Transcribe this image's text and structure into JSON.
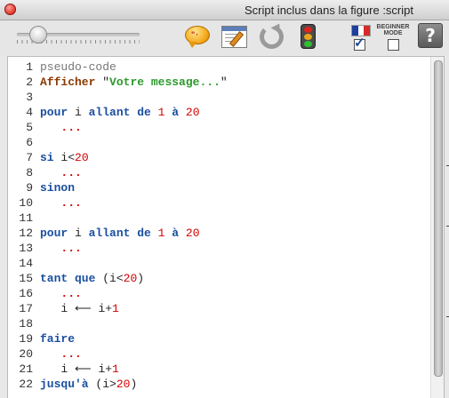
{
  "window": {
    "title": "Script inclus dans la figure :script"
  },
  "toolbar": {
    "slider_value": 0.15,
    "icons": [
      "speech-bubble-icon",
      "editor-window-icon",
      "refresh-icon",
      "traffic-light-icon",
      "french-flag-icon",
      "help-icon"
    ],
    "beginner_line1": "BEGINNER",
    "beginner_line2": "MODE",
    "language_checked": true,
    "beginner_checked": false,
    "help_label": "?"
  },
  "colors": {
    "keyword": "#1b4fa0",
    "string": "#2c9a2c",
    "number": "#d40000",
    "function": "#8b3a00",
    "comment": "#777777"
  },
  "code": {
    "lines": [
      {
        "num": "1",
        "tokens": [
          {
            "t": "pseudo-code",
            "c": "cmt"
          }
        ]
      },
      {
        "num": "2",
        "tokens": [
          {
            "t": "Afficher",
            "c": "fn"
          },
          {
            "t": " ",
            "c": "plain"
          },
          {
            "t": "\"",
            "c": "plain"
          },
          {
            "t": "Votre message...",
            "c": "str"
          },
          {
            "t": "\"",
            "c": "plain"
          }
        ]
      },
      {
        "num": "3",
        "tokens": []
      },
      {
        "num": "4",
        "tokens": [
          {
            "t": "pour",
            "c": "kw"
          },
          {
            "t": " i ",
            "c": "plain"
          },
          {
            "t": "allant de",
            "c": "kw"
          },
          {
            "t": " ",
            "c": "plain"
          },
          {
            "t": "1",
            "c": "num"
          },
          {
            "t": " ",
            "c": "plain"
          },
          {
            "t": "à",
            "c": "kw"
          },
          {
            "t": " ",
            "c": "plain"
          },
          {
            "t": "20",
            "c": "num"
          }
        ]
      },
      {
        "num": "5",
        "tokens": [
          {
            "t": "   ",
            "c": "plain"
          },
          {
            "t": "...",
            "c": "dots"
          }
        ]
      },
      {
        "num": "6",
        "tokens": []
      },
      {
        "num": "7",
        "tokens": [
          {
            "t": "si",
            "c": "kw"
          },
          {
            "t": " i<",
            "c": "plain"
          },
          {
            "t": "20",
            "c": "num"
          }
        ]
      },
      {
        "num": "8",
        "tokens": [
          {
            "t": "   ",
            "c": "plain"
          },
          {
            "t": "...",
            "c": "dots"
          }
        ]
      },
      {
        "num": "9",
        "tokens": [
          {
            "t": "sinon",
            "c": "kw"
          }
        ]
      },
      {
        "num": "10",
        "tokens": [
          {
            "t": "   ",
            "c": "plain"
          },
          {
            "t": "...",
            "c": "dots"
          }
        ]
      },
      {
        "num": "11",
        "tokens": []
      },
      {
        "num": "12",
        "tokens": [
          {
            "t": "pour",
            "c": "kw"
          },
          {
            "t": " i ",
            "c": "plain"
          },
          {
            "t": "allant de",
            "c": "kw"
          },
          {
            "t": " ",
            "c": "plain"
          },
          {
            "t": "1",
            "c": "num"
          },
          {
            "t": " ",
            "c": "plain"
          },
          {
            "t": "à",
            "c": "kw"
          },
          {
            "t": " ",
            "c": "plain"
          },
          {
            "t": "20",
            "c": "num"
          }
        ]
      },
      {
        "num": "13",
        "tokens": [
          {
            "t": "   ",
            "c": "plain"
          },
          {
            "t": "...",
            "c": "dots"
          }
        ]
      },
      {
        "num": "14",
        "tokens": []
      },
      {
        "num": "15",
        "tokens": [
          {
            "t": "tant que",
            "c": "kw"
          },
          {
            "t": " (i<",
            "c": "plain"
          },
          {
            "t": "20",
            "c": "num"
          },
          {
            "t": ")",
            "c": "plain"
          }
        ]
      },
      {
        "num": "16",
        "tokens": [
          {
            "t": "   ",
            "c": "plain"
          },
          {
            "t": "...",
            "c": "dots"
          }
        ]
      },
      {
        "num": "17",
        "tokens": [
          {
            "t": "   i ⟵ i+",
            "c": "plain"
          },
          {
            "t": "1",
            "c": "num"
          }
        ]
      },
      {
        "num": "18",
        "tokens": []
      },
      {
        "num": "19",
        "tokens": [
          {
            "t": "faire",
            "c": "kw"
          }
        ]
      },
      {
        "num": "20",
        "tokens": [
          {
            "t": "   ",
            "c": "plain"
          },
          {
            "t": "...",
            "c": "dots"
          }
        ]
      },
      {
        "num": "21",
        "tokens": [
          {
            "t": "   i ⟵ i+",
            "c": "plain"
          },
          {
            "t": "1",
            "c": "num"
          }
        ]
      },
      {
        "num": "22",
        "tokens": [
          {
            "t": "jusqu'à",
            "c": "kw"
          },
          {
            "t": " (i>",
            "c": "plain"
          },
          {
            "t": "20",
            "c": "num"
          },
          {
            "t": ")",
            "c": "plain"
          }
        ]
      }
    ]
  }
}
